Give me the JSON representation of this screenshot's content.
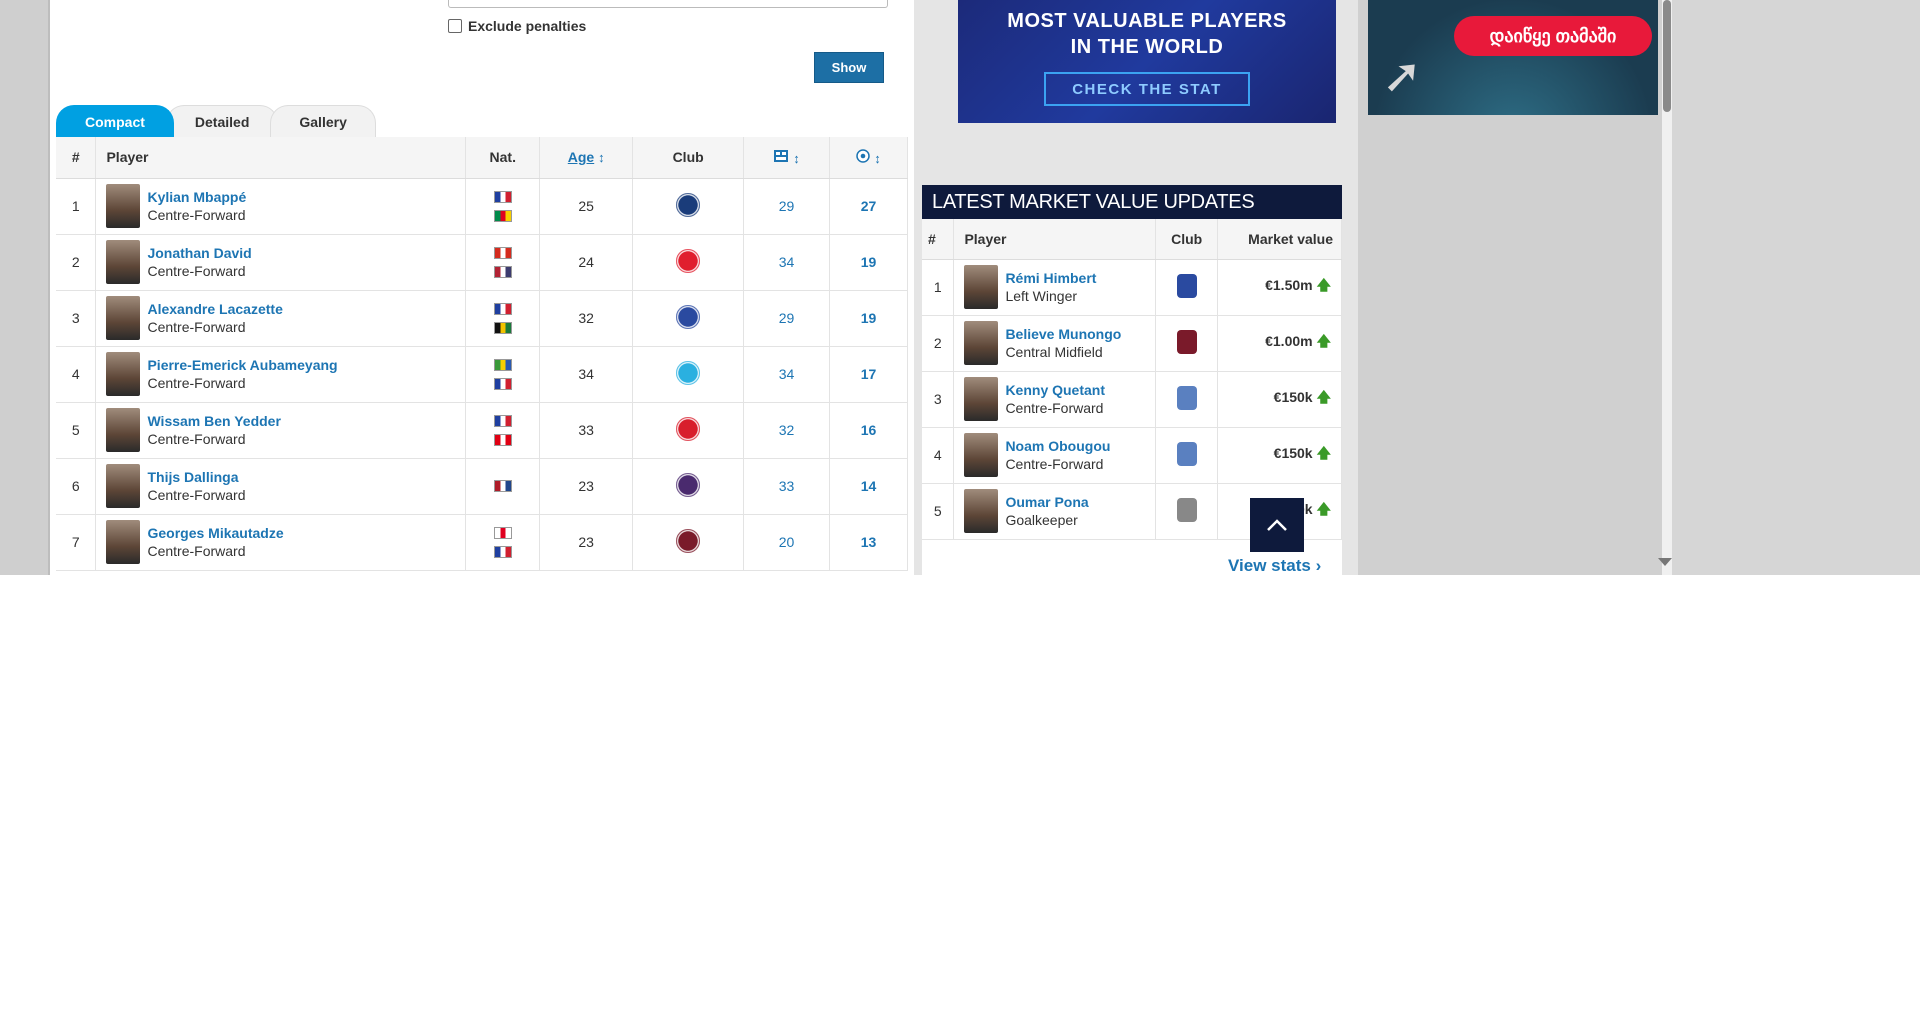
{
  "filter": {
    "exclude_penalties_label": "Exclude penalties",
    "show_label": "Show"
  },
  "tabs": [
    {
      "label": "Compact",
      "active": true
    },
    {
      "label": "Detailed",
      "active": false
    },
    {
      "label": "Gallery",
      "active": false
    }
  ],
  "scorers": {
    "headers": {
      "rank": "#",
      "player": "Player",
      "nat": "Nat.",
      "age": "Age",
      "club": "Club",
      "matches_icon": "matches-icon",
      "goals_icon": "goals-icon",
      "sort_icon": "↕"
    },
    "rows": [
      {
        "rank": "1",
        "name": "Kylian Mbappé",
        "position": "Centre-Forward",
        "flags": [
          "#1f3fa0|#ffffff|#d02030",
          "#008a4b|#e00020|#f7d000"
        ],
        "age": "25",
        "club_color": "#1a3c7a",
        "matches": "29",
        "goals": "27"
      },
      {
        "rank": "2",
        "name": "Jonathan David",
        "position": "Centre-Forward",
        "flags": [
          "#d52b1e|#ffffff|#d52b1e",
          "#b22234|#ffffff|#3c3b6e"
        ],
        "age": "24",
        "club_color": "#e01e2e",
        "matches": "34",
        "goals": "19"
      },
      {
        "rank": "3",
        "name": "Alexandre Lacazette",
        "position": "Centre-Forward",
        "flags": [
          "#1f3fa0|#ffffff|#d02030",
          "#111111|#f2c200|#1a7a3a"
        ],
        "age": "32",
        "club_color": "#2a4aa0",
        "matches": "29",
        "goals": "19"
      },
      {
        "rank": "4",
        "name": "Pierre-Emerick Aubameyang",
        "position": "Centre-Forward",
        "flags": [
          "#3a9a3a|#f7d000|#2a5ab0",
          "#1f3fa0|#ffffff|#d02030"
        ],
        "age": "34",
        "club_color": "#2ab0e0",
        "matches": "34",
        "goals": "17"
      },
      {
        "rank": "5",
        "name": "Wissam Ben Yedder",
        "position": "Centre-Forward",
        "flags": [
          "#1f3fa0|#ffffff|#d02030",
          "#e00013|#ffffff|#e00013"
        ],
        "age": "33",
        "club_color": "#d81e2c",
        "matches": "32",
        "goals": "16"
      },
      {
        "rank": "6",
        "name": "Thijs Dallinga",
        "position": "Centre-Forward",
        "flags": [
          "#ae1c28|#ffffff|#21468b"
        ],
        "age": "23",
        "club_color": "#4a2a6e",
        "matches": "33",
        "goals": "14"
      },
      {
        "rank": "7",
        "name": "Georges Mikautadze",
        "position": "Centre-Forward",
        "flags": [
          "#ffffff|#e00020|#ffffff",
          "#1f3fa0|#ffffff|#d02030"
        ],
        "age": "23",
        "club_color": "#7a1a2a",
        "matches": "20",
        "goals": "13"
      }
    ]
  },
  "banner": {
    "title_line1": "MOST VALUABLE PLAYERS",
    "title_line2": "IN THE WORLD",
    "cta": "CHECK THE STAT"
  },
  "market": {
    "title": "LATEST MARKET VALUE UPDATES",
    "headers": {
      "rank": "#",
      "player": "Player",
      "club": "Club",
      "value": "Market value"
    },
    "rows": [
      {
        "rank": "1",
        "name": "Rémi Himbert",
        "position": "Left Winger",
        "club_color": "#2a4aa0",
        "value": "€1.50m"
      },
      {
        "rank": "2",
        "name": "Believe Munongo",
        "position": "Central Midfield",
        "club_color": "#7a1a2a",
        "value": "€1.00m"
      },
      {
        "rank": "3",
        "name": "Kenny Quetant",
        "position": "Centre-Forward",
        "club_color": "#5a80c0",
        "value": "€150k"
      },
      {
        "rank": "4",
        "name": "Noam Obougou",
        "position": "Centre-Forward",
        "club_color": "#5a80c0",
        "value": "€150k"
      },
      {
        "rank": "5",
        "name": "Oumar Pona",
        "position": "Goalkeeper",
        "club_color": "#888888",
        "value": "€150k"
      }
    ],
    "up_arrow": "🡅",
    "view_stats": "View stats",
    "chevron": "›"
  },
  "ad": {
    "button_text": "დაიწყე თამაში",
    "arrow_glyph": "➚"
  },
  "to_top_glyph": "︿",
  "colors": {
    "accent": "#00a0e2",
    "link": "#1d75b3",
    "header_dark": "#0e1a3c",
    "up": "#3a9a28"
  }
}
